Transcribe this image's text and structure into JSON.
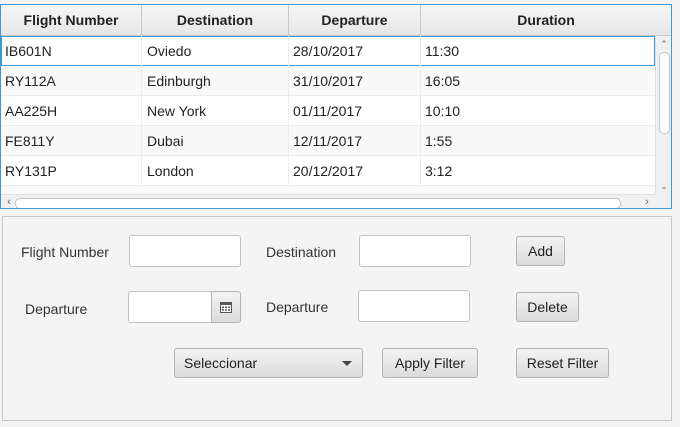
{
  "table": {
    "columns": [
      "Flight Number",
      "Destination",
      "Departure",
      "Duration"
    ],
    "rows": [
      {
        "flight": "IB601N",
        "destination": "Oviedo",
        "departure": "28/10/2017",
        "duration": "11:30"
      },
      {
        "flight": "RY112A",
        "destination": "Edinburgh",
        "departure": "31/10/2017",
        "duration": "16:05"
      },
      {
        "flight": "AA225H",
        "destination": "New York",
        "departure": "01/11/2017",
        "duration": "10:10"
      },
      {
        "flight": "FE811Y",
        "destination": "Dubai",
        "departure": "12/11/2017",
        "duration": "1:55"
      },
      {
        "flight": "RY131P",
        "destination": "London",
        "departure": "20/12/2017",
        "duration": "3:12"
      }
    ],
    "selected_row": 0
  },
  "form": {
    "flight_number_label": "Flight Number",
    "flight_number_value": "",
    "destination_label": "Destination",
    "destination_value": "",
    "departure_label": "Departure",
    "departure_date_value": "",
    "departure2_label": "Departure",
    "departure2_value": "",
    "add_label": "Add",
    "delete_label": "Delete",
    "filter_combo_value": "Seleccionar",
    "apply_filter_label": "Apply Filter",
    "reset_filter_label": "Reset Filter"
  },
  "icons": {
    "calendar": "calendar-icon",
    "scroll_up": "chevron-up-icon",
    "scroll_down": "chevron-down-icon",
    "scroll_left": "chevron-left-icon",
    "scroll_right": "chevron-right-icon",
    "combo_arrow": "caret-down-icon"
  },
  "colors": {
    "focus_border": "#3d9ad6"
  }
}
